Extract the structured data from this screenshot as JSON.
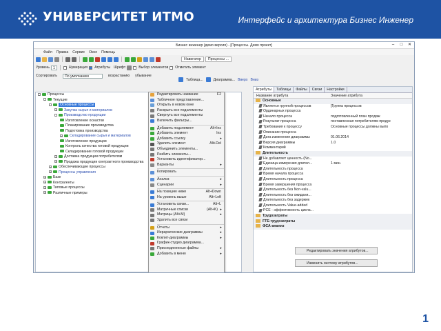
{
  "banner": {
    "logo_text": "УНИВЕРСИТЕТ ИТМО",
    "title": "Интерфейс и архитектура Бизнес Инженер",
    "page_number": "1",
    "color": "#1e53a4"
  },
  "window": {
    "title": "Бизнес инженер (демо версия) - [Процессы. Демо проект]"
  },
  "menubar": [
    "Файл",
    "Правка",
    "Сервис",
    "Окно",
    "Помощь"
  ],
  "toolbar2": {
    "level_label": "Уровень",
    "level_value": "1",
    "numbering": "Нумерация",
    "attributes": "Атрибуты",
    "font_label": "Шрифт",
    "element_select": "Выбор элементов",
    "show_links": "Отметить элемент",
    "navigator": "Навигатор",
    "processes_tab": "Процессы ..."
  },
  "toolbar3": {
    "sort_label": "Сортировать",
    "sort_value": "По умолчанию",
    "asc": "возрастанию",
    "desc": "убывание",
    "table": "Таблица...",
    "diagram": "Диаграмма...",
    "up": "Вверх",
    "down": "Вниз"
  },
  "tree": [
    {
      "label": "Процессы",
      "indent": 0,
      "exp": "-"
    },
    {
      "label": "Текущие",
      "indent": 1,
      "exp": "-"
    },
    {
      "label": "Основные процессы",
      "indent": 2,
      "exp": "-",
      "sel": true
    },
    {
      "label": "Закупка сырья и материалов",
      "indent": 3,
      "exp": "+",
      "blue": true
    },
    {
      "label": "Производство продукции",
      "indent": 3,
      "exp": "-",
      "blue": true
    },
    {
      "label": "Изготовление оснастки",
      "indent": 4
    },
    {
      "label": "Планирование производства",
      "indent": 4
    },
    {
      "label": "Подготовка производства",
      "indent": 4
    },
    {
      "label": "Складирование сырья и материалов",
      "indent": 4,
      "exp": "+",
      "blue": true
    },
    {
      "label": "Изготовление продукции",
      "indent": 4
    },
    {
      "label": "Контроль качества готовой продукции",
      "indent": 4
    },
    {
      "label": "Складирование готовой продукции",
      "indent": 4
    },
    {
      "label": "Доставка продукции потребителям",
      "indent": 3,
      "exp": "+"
    },
    {
      "label": "Продажа продукции контрактного производства",
      "indent": 3,
      "exp": "+"
    },
    {
      "label": "Обеспечивающие процессы",
      "indent": 2,
      "exp": "+"
    },
    {
      "label": "Процессы управления",
      "indent": 2,
      "exp": "+",
      "blue": true
    },
    {
      "label": "Базе",
      "indent": 1,
      "exp": "+"
    },
    {
      "label": "Контрагенты",
      "indent": 1,
      "exp": "+"
    },
    {
      "label": "Типовые процессы",
      "indent": 1,
      "exp": "+"
    },
    {
      "label": "Различные примеры",
      "indent": 1,
      "exp": "+"
    }
  ],
  "context_menu": [
    {
      "label": "Редактировать название",
      "shortcut": "F2",
      "icon": "edit-icon",
      "color": "#e6a23c"
    },
    {
      "label": "Табличное представление...",
      "icon": "table-icon",
      "color": "#5b8fd6"
    },
    {
      "label": "Открыть в новом окне",
      "icon": "new-window-icon",
      "color": "#6a9fd8"
    },
    {
      "label": "Раскрыть все подэлементы",
      "icon": "expand-icon",
      "color": "#7b7b7b"
    },
    {
      "label": "Свернуть все подэлементы",
      "icon": "collapse-icon",
      "color": "#7b7b7b"
    },
    {
      "label": "Включить фильтры...",
      "icon": "filter-icon",
      "color": "#3a7bd5"
    },
    {
      "sep": true
    },
    {
      "label": "Добавить подэлемент",
      "shortcut": "Alt+Ins",
      "icon": "add-child-icon",
      "color": "#3aa83a"
    },
    {
      "label": "Добавить элемент",
      "shortcut": "Ins",
      "icon": "add-icon",
      "color": "#3aa83a"
    },
    {
      "label": "Добавить ссылку",
      "arrow": true,
      "icon": "link-icon",
      "color": "#3aa83a"
    },
    {
      "label": "Удалить элемент",
      "shortcut": "Alt+Del",
      "icon": "delete-icon",
      "color": "#555"
    },
    {
      "label": "Объединить элементы...",
      "icon": "merge-icon",
      "color": "#777"
    },
    {
      "label": "Разбить элементы...",
      "icon": "split-icon",
      "color": "#777"
    },
    {
      "label": "Установить идентификатор...",
      "icon": "id-icon",
      "color": "#c0392b"
    },
    {
      "label": "Варианты",
      "arrow": true,
      "icon": "variants-icon",
      "color": "#888"
    },
    {
      "sep": true
    },
    {
      "label": "Копировать",
      "icon": "copy-icon",
      "color": "#5b8fd6"
    },
    {
      "sep": true
    },
    {
      "label": "Анализ",
      "arrow": true,
      "icon": "analysis-icon",
      "color": "#5b8fd6"
    },
    {
      "label": "Сценарии",
      "arrow": true,
      "icon": "scenario-icon",
      "color": "#888"
    },
    {
      "sep": true
    },
    {
      "label": "На позицию ниже",
      "shortcut": "Alt+Down",
      "icon": "move-down-icon",
      "color": "#3a7bd5"
    },
    {
      "label": "На уровень выше",
      "shortcut": "Alt+Left",
      "icon": "level-up-icon",
      "color": "#3a7bd5"
    },
    {
      "sep": true
    },
    {
      "label": "Установить связи...",
      "shortcut": "Alt+L",
      "icon": "link-set-icon",
      "color": "#3a7bd5"
    },
    {
      "label": "Матричные списки",
      "shortcut": "(Alt+K)",
      "arrow": true,
      "icon": "matrix-icon",
      "color": "#777"
    },
    {
      "label": "Матрицы (Alt+M)",
      "arrow": true,
      "icon": "matrices-icon",
      "color": "#777"
    },
    {
      "label": "Удалить все связи",
      "icon": "unlink-icon",
      "color": "#777"
    },
    {
      "sep": true
    },
    {
      "label": "Отчеты",
      "arrow": true,
      "icon": "reports-icon",
      "color": "#d4a017"
    },
    {
      "label": "Иерархические диаграммы",
      "arrow": true,
      "icon": "hier-diagram-icon",
      "color": "#3a7bd5"
    },
    {
      "label": "Кокпит-диаграммы",
      "arrow": true,
      "icon": "cockpit-icon",
      "color": "#3aa83a"
    },
    {
      "label": "График-студио диаграмма...",
      "icon": "chart-icon",
      "color": "#c0392b"
    },
    {
      "label": "Присоединенные файлы",
      "arrow": true,
      "icon": "attach-icon",
      "color": "#777"
    },
    {
      "label": "Добавить в меню",
      "arrow": true,
      "icon": "menu-add-icon",
      "color": "#3aa83a"
    }
  ],
  "right_tabs": [
    "Атрибуты",
    "Таблицы",
    "Файлы",
    "Связи",
    "Настройки"
  ],
  "props_header": {
    "name": "Название атрибута",
    "value": "Значение атрибута"
  },
  "props": [
    {
      "group": "Основные"
    },
    {
      "name": "Является группой процессов",
      "value": "[Группа процессов"
    },
    {
      "name": "Ординарных процесса",
      "value": ""
    },
    {
      "name": "Начало процесса",
      "value": "подготовленный план продаж"
    },
    {
      "name": "Результат процесса",
      "value": "поставленная потребителям продук"
    },
    {
      "name": "Требования к процессу",
      "value": "Основные процессы должны выпо"
    },
    {
      "name": "Описание процесса",
      "value": ""
    },
    {
      "name": "Дата изменения диаграммы",
      "value": "01.06.2014"
    },
    {
      "name": "Версия диаграммы",
      "value": "1.0"
    },
    {
      "name": "Комментарий",
      "value": ""
    },
    {
      "group": "Длительность"
    },
    {
      "name": "Не добавляет ценность (No...",
      "value": ""
    },
    {
      "name": "Единица измерения длител...",
      "value": "1 мин."
    },
    {
      "name": "Длительность процесса",
      "value": ""
    },
    {
      "name": "Время начала процесса",
      "value": ""
    },
    {
      "name": "Длительность процесса",
      "value": ""
    },
    {
      "name": "Время завершения процесса",
      "value": ""
    },
    {
      "name": "Длительность без Non-valu...",
      "value": ""
    },
    {
      "name": "Длительность без ожидани...",
      "value": ""
    },
    {
      "name": "Длительность без задержек",
      "value": ""
    },
    {
      "name": "Длительность Value-added",
      "value": ""
    },
    {
      "name": "PCE - эффективность цикла...",
      "value": ""
    },
    {
      "group": "Трудозатраты"
    },
    {
      "group": "FTE-трудозатраты"
    },
    {
      "group": "ФСА-анализ"
    }
  ],
  "buttons": {
    "edit_values": "Редактировать значения атрибутов...",
    "change_system": "Изменить систему атрибутов..."
  }
}
